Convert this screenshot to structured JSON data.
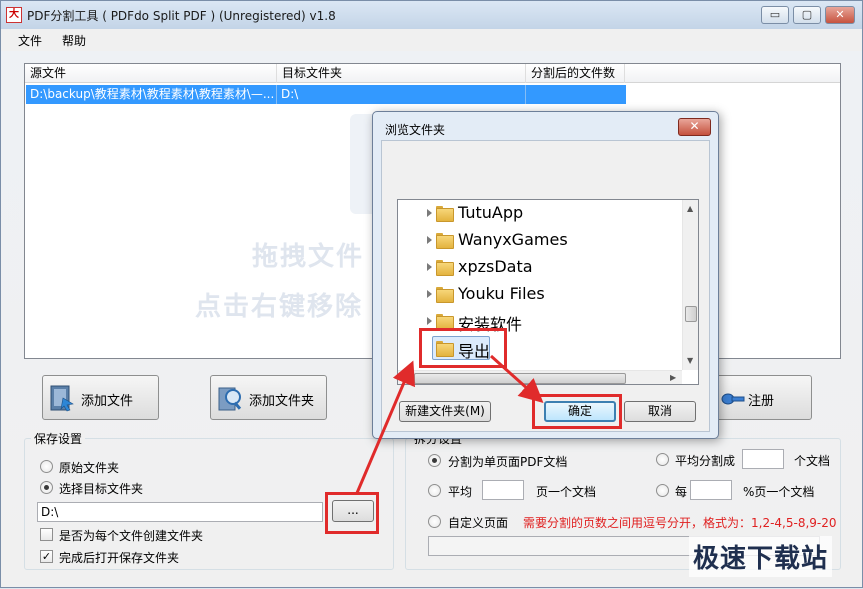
{
  "window": {
    "title": "PDF分割工具 ( PDFdo Split PDF ) (Unregistered) v1.8",
    "app_icon_text": "大",
    "min_glyph": "▭",
    "max_glyph": "▢",
    "close_glyph": "✕"
  },
  "menu": {
    "items": [
      "文件",
      "帮助"
    ]
  },
  "file_list": {
    "columns": [
      "源文件",
      "目标文件夹",
      "分割后的文件数"
    ],
    "rows": [
      {
        "source": "D:\\backup\\教程素材\\教程素材\\教程素材\\—...",
        "target": "D:\\",
        "count": ""
      }
    ],
    "watermark_line1": "拖拽文件",
    "watermark_line2": "点击右键移除"
  },
  "toolbar": {
    "add_file": "添加文件",
    "add_folder": "添加文件夹",
    "register": "注册"
  },
  "save_settings": {
    "title": "保存设置",
    "original_folder": "原始文件夹",
    "choose_target": "选择目标文件夹",
    "path_value": "D:\\",
    "browse_label": "...",
    "create_per_file": "是否为每个文件创建文件夹",
    "open_after": "完成后打开保存文件夹",
    "create_per_file_checked": false,
    "open_after_checked": true,
    "selected": "choose_target"
  },
  "split_settings": {
    "title": "拆分设置",
    "single_page": "分割为单页面PDF文档",
    "average_split": "平均分割成",
    "docs_suffix": "个文档",
    "average": "平均",
    "pages_per_doc": "页一个文档",
    "every": "每",
    "percent_per_doc": "%页一个文档",
    "custom_pages": "自定义页面",
    "custom_hint": "需要分割的页数之间用逗号分开，格式为：1,2-4,5-8,9-20",
    "selected": "single_page"
  },
  "dialog": {
    "title": "浏览文件夹",
    "close_glyph": "✕",
    "folders": [
      "TutuApp",
      "WanyxGames",
      "xpzsData",
      "Youku Files",
      "安装软件",
      "导出"
    ],
    "selected_folder": "导出",
    "ok_label": "确定",
    "cancel_label": "取消",
    "new_folder_label": "新建文件夹(M)"
  },
  "site_watermark": "极速下载站",
  "colors": {
    "accent": "#3399ff",
    "highlight": "#e02b2b"
  }
}
